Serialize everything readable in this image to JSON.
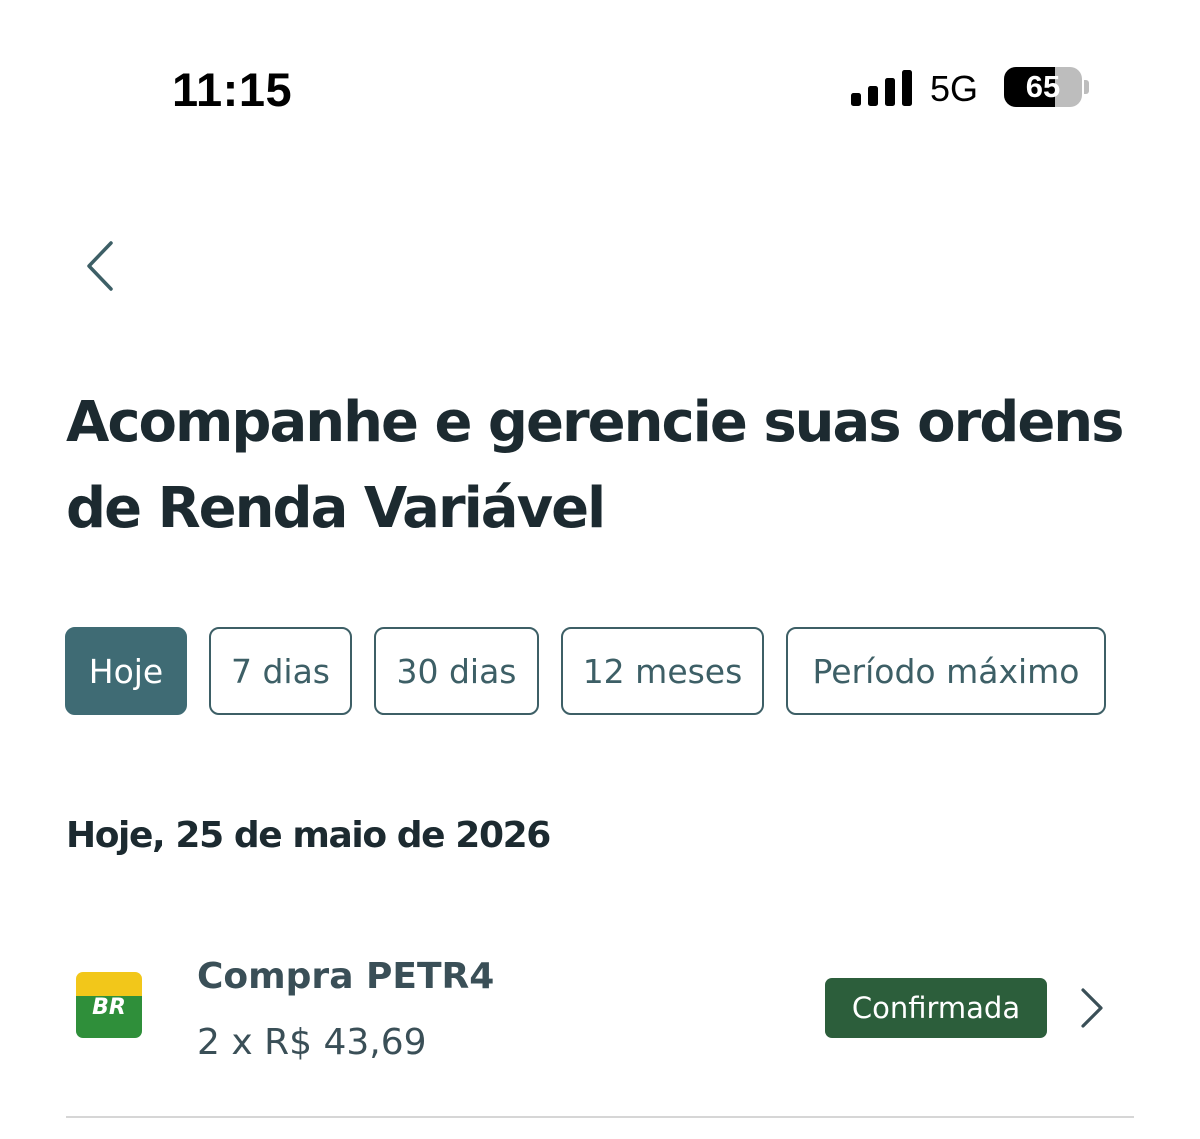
{
  "status_bar": {
    "time": "11:15",
    "network": "5G",
    "battery_percent": "65",
    "battery_level": 0.65,
    "signal_bars": 4
  },
  "nav": {
    "back_icon": "chevron-left-icon"
  },
  "title": "Acompanhe e gerencie suas ordens de Renda Variável",
  "filters": [
    {
      "label": "Hoje",
      "active": true
    },
    {
      "label": "7 dias",
      "active": false
    },
    {
      "label": "30 dias",
      "active": false
    },
    {
      "label": "12 meses",
      "active": false
    },
    {
      "label": "Período máximo",
      "active": false
    }
  ],
  "section": {
    "date_heading": "Hoje, 25 de maio de 2026"
  },
  "orders": [
    {
      "logo_text": "BR",
      "title": "Compra PETR4",
      "detail": "2 x R$ 43,69",
      "status": "Confirmada",
      "chevron_icon": "chevron-right-icon"
    }
  ],
  "colors": {
    "accent": "#3f6b74",
    "chip_border": "#3d5f66",
    "text_dark": "#1c2a30",
    "badge_confirmed": "#2c5e3b",
    "divider": "#d6d6d6",
    "logo_yellow": "#f2c71a",
    "logo_green": "#2f8f3a"
  }
}
